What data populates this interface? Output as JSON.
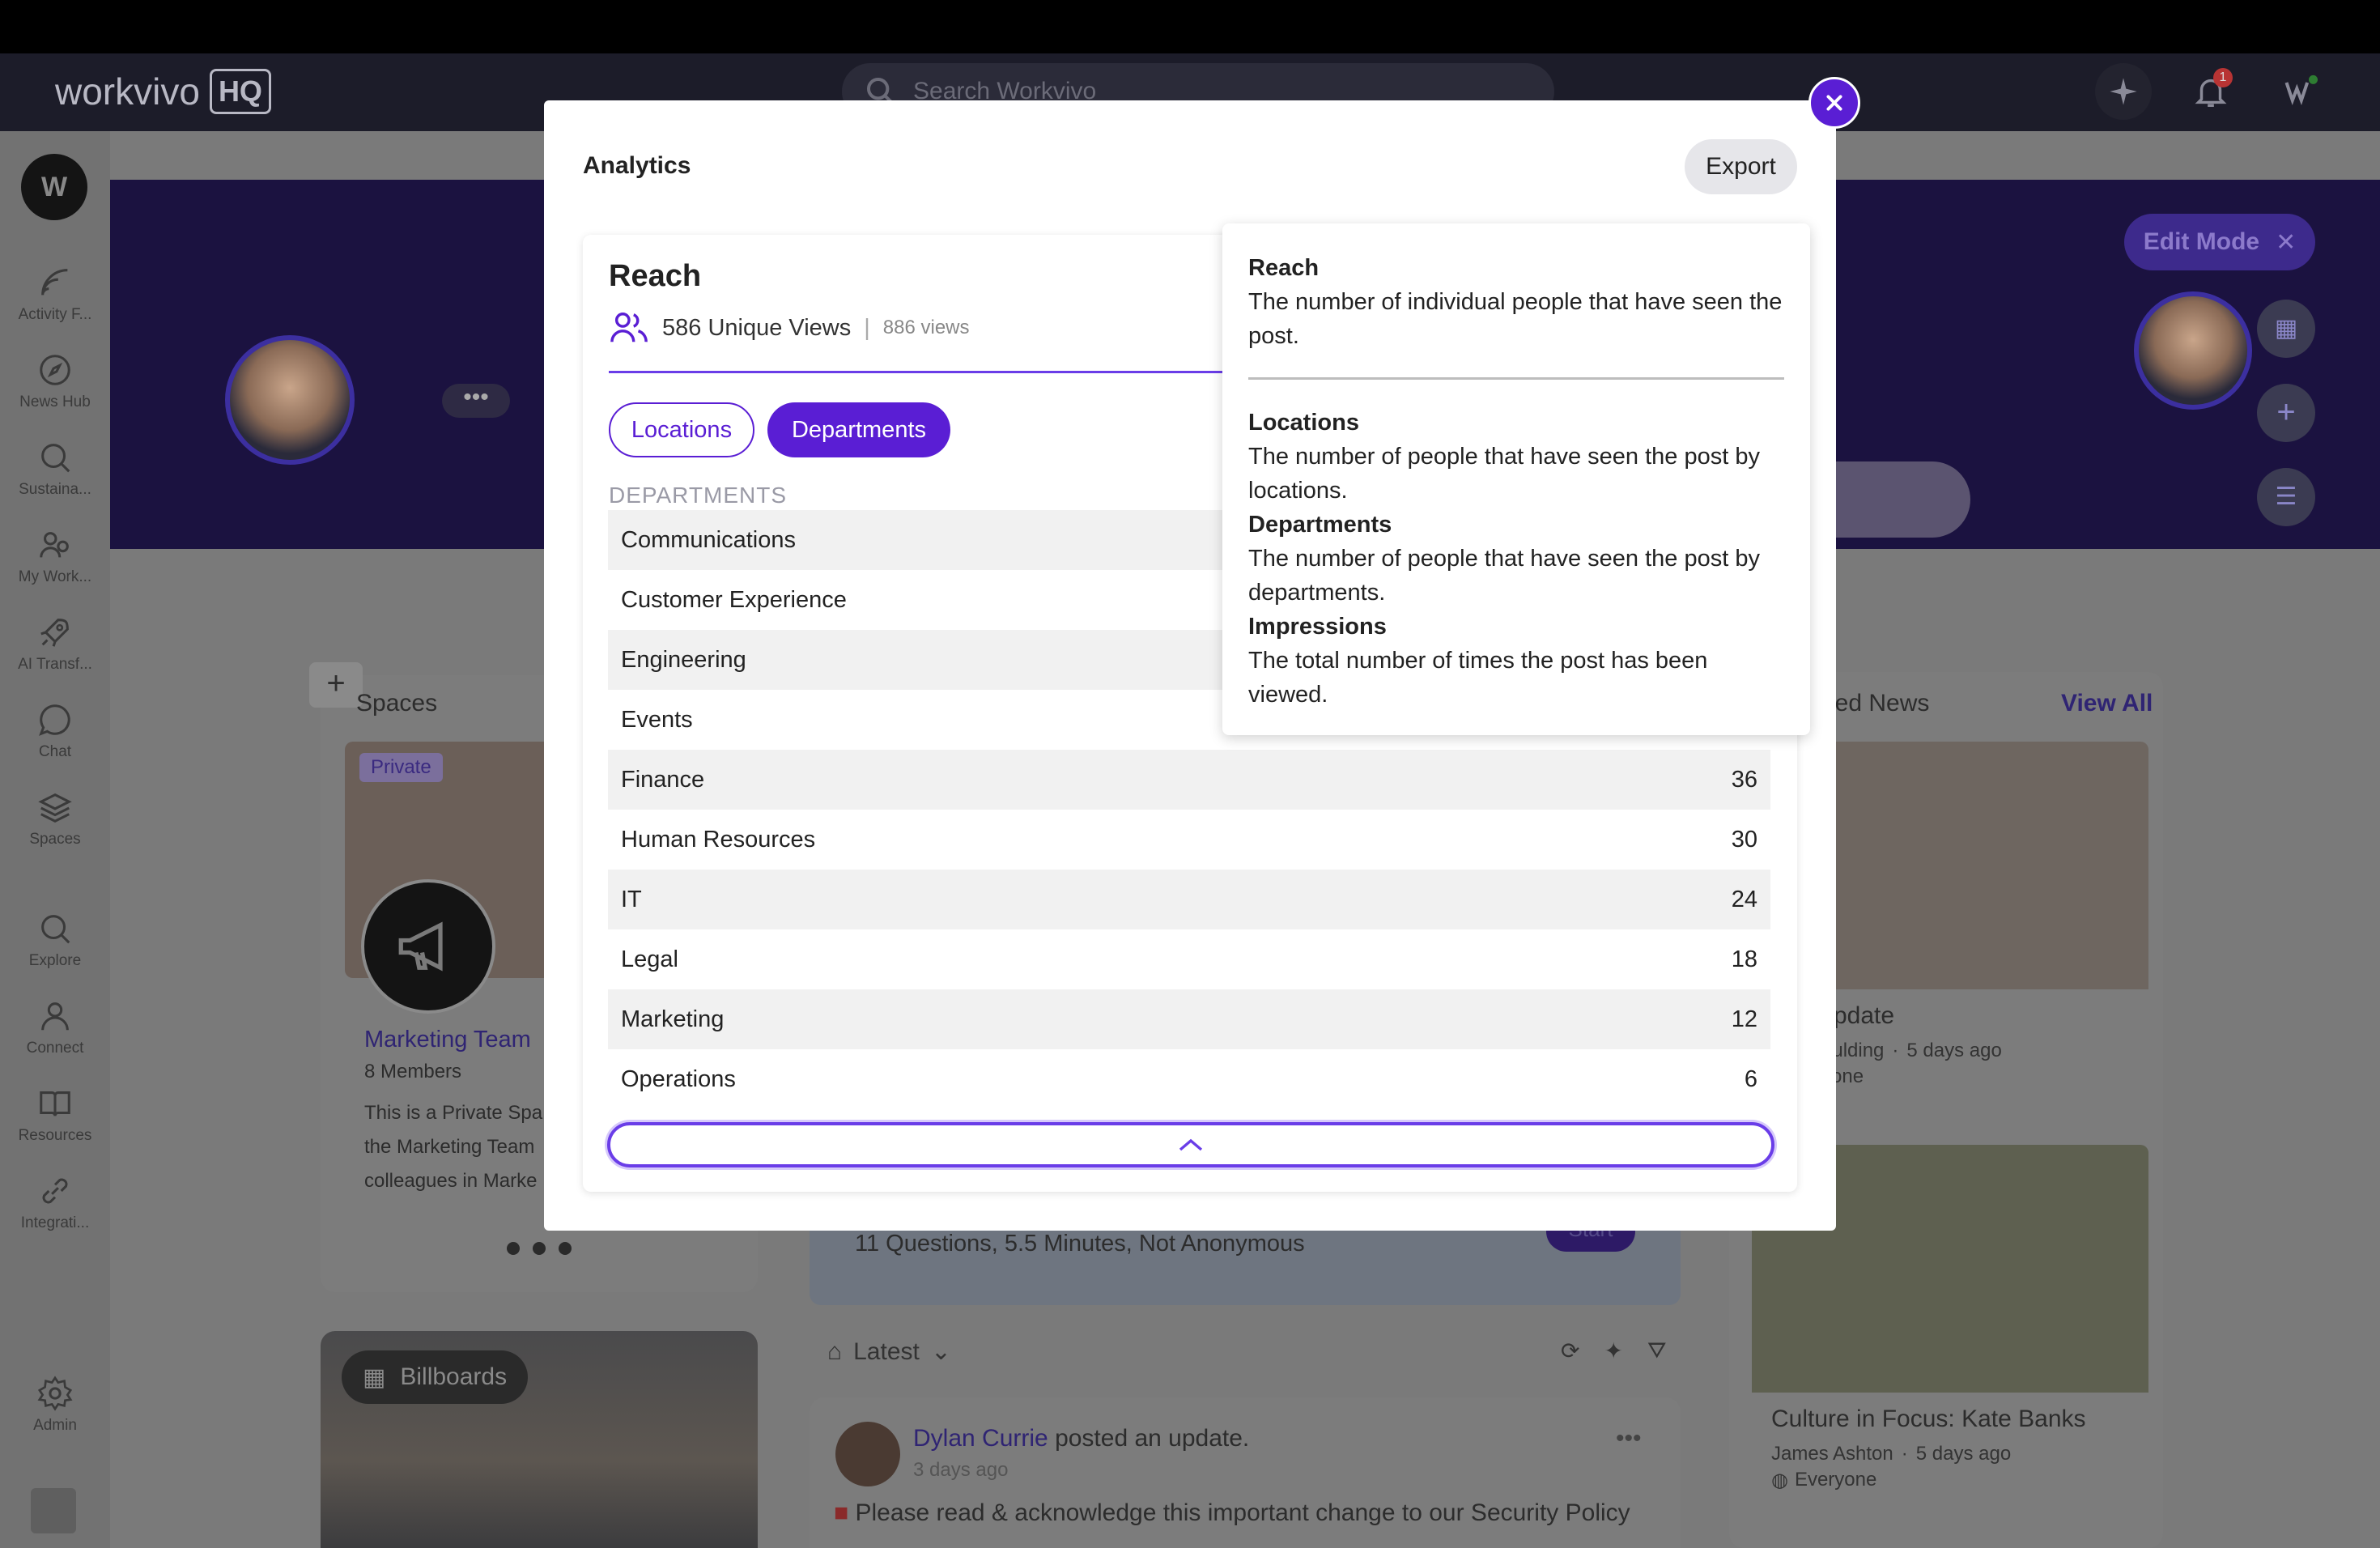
{
  "app": {
    "logo_word": "workvivo",
    "logo_badge": "HQ",
    "search_placeholder": "Search Workvivo",
    "notification_count": "1"
  },
  "sidebar": {
    "items": [
      {
        "label": "Activity F...",
        "icon": "activity-feed-icon"
      },
      {
        "label": "News Hub",
        "icon": "compass-icon"
      },
      {
        "label": "Sustaina...",
        "icon": "search-icon"
      },
      {
        "label": "My Work...",
        "icon": "people-icon"
      },
      {
        "label": "AI Transf...",
        "icon": "rocket-icon"
      },
      {
        "label": "Chat",
        "icon": "chat-icon"
      },
      {
        "label": "Spaces",
        "icon": "layers-icon"
      },
      {
        "label": "Explore",
        "icon": "search-icon"
      },
      {
        "label": "Connect",
        "icon": "person-icon"
      },
      {
        "label": "Resources",
        "icon": "book-icon"
      },
      {
        "label": "Integrati...",
        "icon": "link-icon"
      },
      {
        "label": "Admin",
        "icon": "gear-icon"
      }
    ]
  },
  "background": {
    "edit_mode": "Edit Mode",
    "spaces_title": "Spaces",
    "private_badge": "Private",
    "space_name": "Marketing Team",
    "space_members": "8 Members",
    "space_desc": [
      "This is a Private Spa",
      "the Marketing Team",
      "colleagues in Marke"
    ],
    "billboards": "Billboards",
    "survey_meta": "11 Questions, 5.5 Minutes, Not Anonymous",
    "survey_button": "Start",
    "feed_filter": "Latest",
    "post_author": "Dylan Currie",
    "post_action": "posted an update.",
    "post_time": "3 days ago",
    "post_text": "Please read & acknowledge this important change to our Security Policy",
    "news_title": "ured News",
    "view_all": "View All",
    "news1_title": "Jpdate",
    "news1_author": "oulding",
    "news1_time": "5 days ago",
    "news1_audience": "yone",
    "news2_title": "Culture in Focus: Kate Banks",
    "news2_author": "James Ashton",
    "news2_time": "5 days ago",
    "news2_audience": "Everyone"
  },
  "modal": {
    "title": "Analytics",
    "export_label": "Export",
    "reach_title": "Reach",
    "unique_views": "586 Unique Views",
    "total_views": "886 views",
    "tabs": [
      {
        "label": "Locations",
        "active": false
      },
      {
        "label": "Departments",
        "active": true
      }
    ],
    "table_header": "DEPARTMENTS",
    "rows": [
      {
        "name": "Communications",
        "value": ""
      },
      {
        "name": "Customer Experience",
        "value": ""
      },
      {
        "name": "Engineering",
        "value": ""
      },
      {
        "name": "Events",
        "value": ""
      },
      {
        "name": "Finance",
        "value": "36"
      },
      {
        "name": "Human Resources",
        "value": "30"
      },
      {
        "name": "IT",
        "value": "24"
      },
      {
        "name": "Legal",
        "value": "18"
      },
      {
        "name": "Marketing",
        "value": "12"
      },
      {
        "name": "Operations",
        "value": "6"
      }
    ]
  },
  "tooltip": {
    "reach_title": "Reach",
    "reach_desc": "The number of individual people that have seen the post.",
    "locations_title": "Locations",
    "locations_desc": "The number of people that have seen the post by locations.",
    "departments_title": "Departments",
    "departments_desc": "The number of people that have seen the post by departments.",
    "impressions_title": "Impressions",
    "impressions_desc": "The total number of times the post has been viewed."
  },
  "colors": {
    "accent": "#5a1ed4",
    "overlay": "#7a7a7a",
    "appbar": "#1c1c29"
  }
}
